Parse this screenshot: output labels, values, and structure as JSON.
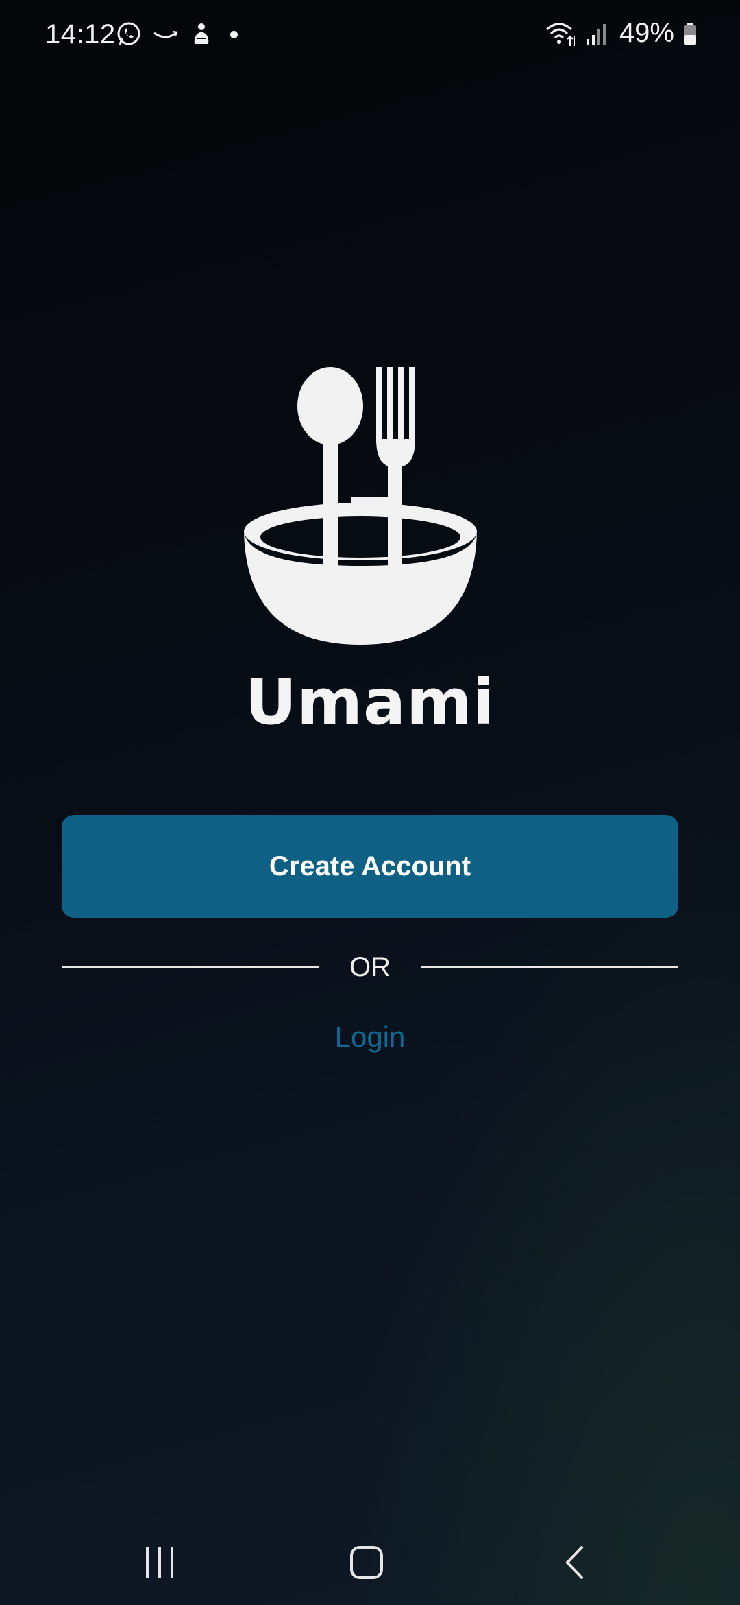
{
  "status_bar": {
    "time": "14:12",
    "notification_icons": [
      "whatsapp-icon",
      "amazon-icon",
      "app-notification-icon",
      "more-dot-icon"
    ],
    "battery_percent": "49%",
    "system_icons": [
      "wifi-icon",
      "signal-icon",
      "battery-icon"
    ]
  },
  "app": {
    "name": "Umami",
    "logo_icon": "bowl-spoon-fork-icon"
  },
  "actions": {
    "create_account_label": "Create Account",
    "divider_label": "OR",
    "login_label": "Login"
  },
  "nav_bar": {
    "buttons": [
      "recents-icon",
      "home-icon",
      "back-icon"
    ]
  },
  "colors": {
    "primary_button": "#0e6185",
    "login_link": "#0f6a93",
    "background": "#070b12",
    "logo": "#f2f2f2"
  }
}
